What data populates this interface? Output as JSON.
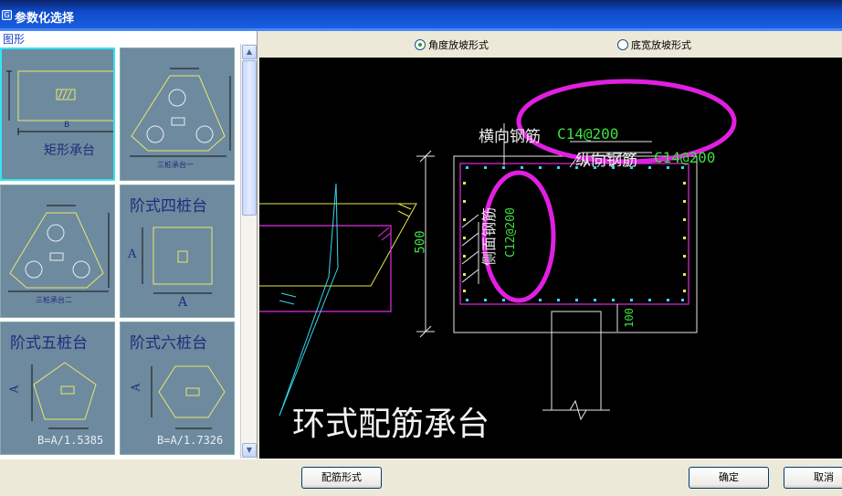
{
  "window": {
    "title": "参数化选择"
  },
  "left_panel": {
    "group_label": "图形",
    "thumbnails": [
      {
        "label": "矩形承台",
        "dim_B": "B"
      },
      {
        "label": "三桩承台一"
      },
      {
        "label": "三桩承台二"
      },
      {
        "label": "阶式四桩台",
        "dim_A_left": "A",
        "dim_A_bottom": "A"
      },
      {
        "label": "阶式五桩台",
        "dim_A": "A",
        "formula": "B=A/1.5385"
      },
      {
        "label": "阶式六桩台",
        "dim_A": "A",
        "formula": "B=A/1.7326"
      }
    ],
    "scroll_up": "▲",
    "scroll_down": "▼"
  },
  "options": {
    "radio_angle": {
      "label": "角度放坡形式",
      "selected": true
    },
    "radio_width": {
      "label": "底宽放坡形式",
      "selected": false
    }
  },
  "drawing": {
    "transverse_label": "横向钢筋",
    "transverse_spec": "C14@200",
    "longitudinal_label": "纵向钢筋",
    "longitudinal_spec": "C14@200",
    "side_label": "侧面钢筋",
    "side_spec": "C12@200",
    "dim_height": "500",
    "dim_base": "100",
    "title": "环式配筋承台"
  },
  "buttons": {
    "rebar_form": "配筋形式",
    "ok": "确定",
    "cancel": "取消"
  },
  "colors": {
    "titlebar": "#0F4BC9",
    "cad_background": "#000000",
    "highlight_ellipse": "#E020E0",
    "rebar_spec": "#3EE040",
    "thumb_bg": "#6E8A9F",
    "thumb_line": "#E8E86A"
  }
}
